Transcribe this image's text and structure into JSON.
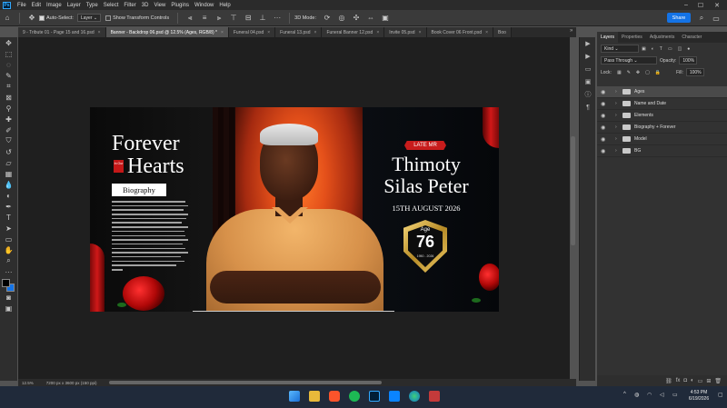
{
  "menu": [
    "File",
    "Edit",
    "Image",
    "Layer",
    "Type",
    "Select",
    "Filter",
    "3D",
    "View",
    "Plugins",
    "Window",
    "Help"
  ],
  "app_logo": "Ps",
  "options": {
    "auto_select_label": "Auto-Select:",
    "auto_select_value": "Layer",
    "transform_label": "Show Transform Controls",
    "mode_3d_label": "3D Mode:",
    "share_label": "Share"
  },
  "tabs": [
    {
      "label": "9 - Tribute 01 - Page 15 and 16.psd",
      "active": false
    },
    {
      "label": "Banner - Backdrop 06.psd @ 12.5% (Ages, RGB/8) *",
      "active": true
    },
    {
      "label": "Funeral 04.psd",
      "active": false
    },
    {
      "label": "Funeral 13.psd",
      "active": false
    },
    {
      "label": "Funeral Banner 12.psd",
      "active": false
    },
    {
      "label": "Invite 05.psd",
      "active": false
    },
    {
      "label": "Book Cover 06 Front.psd",
      "active": false
    },
    {
      "label": "Boo",
      "active": false
    }
  ],
  "banner": {
    "title_line1": "Forever",
    "title_in_our": "In Our",
    "title_line2": "Hearts",
    "biography": "Biography",
    "late_label": "LATE MR",
    "name_line1": "Thimoty",
    "name_line2": "Silas Peter",
    "date": "15TH AUGUST 2026",
    "age_label": "Age",
    "age_value": "76",
    "years": "1950 - 2026"
  },
  "panel": {
    "tabs": [
      "Layers",
      "Properties",
      "Adjustments",
      "Character"
    ],
    "active_tab": "Layers",
    "filter_kind": "Kind",
    "blend_mode": "Pass Through",
    "opacity_label": "Opacity:",
    "opacity_value": "100%",
    "lock_label": "Lock:",
    "fill_label": "Fill:",
    "fill_value": "100%",
    "layers": [
      {
        "name": "Ages",
        "selected": true
      },
      {
        "name": "Name and Date",
        "selected": false
      },
      {
        "name": "Elements",
        "selected": false
      },
      {
        "name": "Biography + Forever",
        "selected": false
      },
      {
        "name": "Model",
        "selected": false
      },
      {
        "name": "BG",
        "selected": false
      }
    ]
  },
  "status": {
    "zoom": "12.5%",
    "doc_size": "7200 px x 3600 px (150 ppi)"
  },
  "taskbar": {
    "time": "4:53 PM",
    "date": "6/19/2026"
  },
  "colors": {
    "accent": "#1473e6",
    "banner_red": "#c81c1c",
    "gold": "#d8b04a"
  }
}
